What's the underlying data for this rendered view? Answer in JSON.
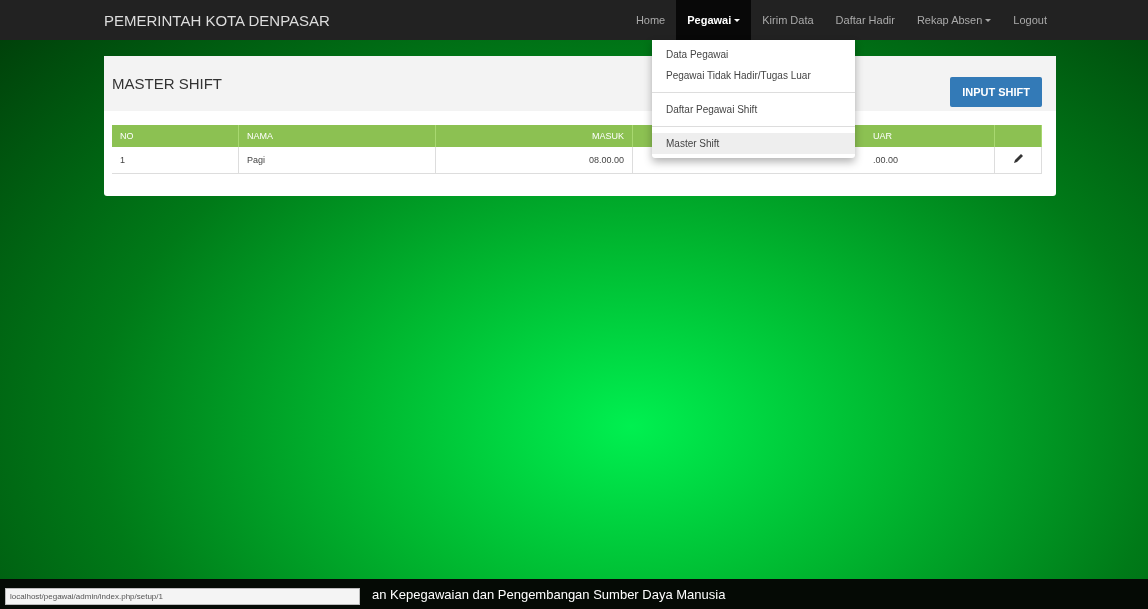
{
  "navbar": {
    "brand": "PEMERINTAH KOTA DENPASAR",
    "items": [
      {
        "label": "Home",
        "dropdown": false,
        "selected": false
      },
      {
        "label": "Pegawai",
        "dropdown": true,
        "selected": true
      },
      {
        "label": "Kirim Data",
        "dropdown": false,
        "selected": false
      },
      {
        "label": "Daftar Hadir",
        "dropdown": false,
        "selected": false
      },
      {
        "label": "Rekap Absen",
        "dropdown": true,
        "selected": false
      },
      {
        "label": "Logout",
        "dropdown": false,
        "selected": false
      }
    ]
  },
  "dropdown_menu": {
    "groups": [
      [
        {
          "label": "Data Pegawai",
          "selected": false
        },
        {
          "label": "Pegawai Tidak Hadir/Tugas Luar",
          "selected": false
        }
      ],
      [
        {
          "label": "Daftar Pegawai Shift",
          "selected": false
        }
      ],
      [
        {
          "label": "Master Shift",
          "selected": true
        }
      ]
    ]
  },
  "panel": {
    "title": "MASTER SHIFT",
    "button": "INPUT SHIFT",
    "table": {
      "columns": [
        "NO",
        "NAMA",
        "MASUK",
        "UAR"
      ],
      "rows": [
        [
          "1",
          "Pagi",
          "08.00.00",
          ".00.00"
        ]
      ]
    }
  },
  "footer": {
    "text": "an Kepegawaian dan Pengembangan Sumber Daya Manusia"
  },
  "status_bar": {
    "url": "localhost/pegawai/admin/index.php/setup/1"
  }
}
